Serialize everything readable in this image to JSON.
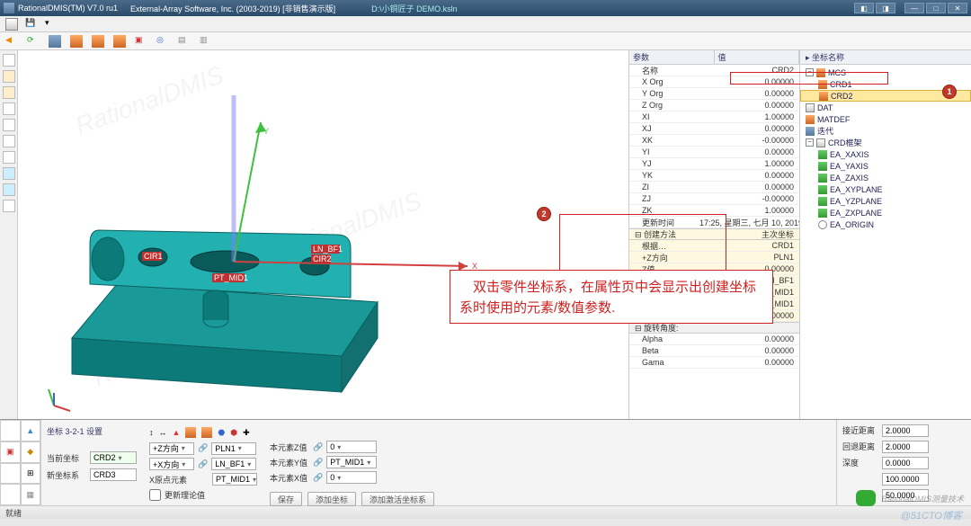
{
  "title": {
    "app": "RationalDMIS(TM) V7.0 ru1",
    "vendor": "External-Array Software, Inc. (2003-2019) [非销售演示版]",
    "file": "D:\\小铜匠子  DEMO.ksln"
  },
  "props": {
    "header_param": "参数",
    "header_value": "值",
    "rows": [
      {
        "k": "名称",
        "v": "CRD2"
      },
      {
        "k": "X Org",
        "v": "0.00000"
      },
      {
        "k": "Y Org",
        "v": "0.00000"
      },
      {
        "k": "Z Org",
        "v": "0.00000"
      },
      {
        "k": "XI",
        "v": "1.00000"
      },
      {
        "k": "XJ",
        "v": "0.00000"
      },
      {
        "k": "XK",
        "v": "-0.00000"
      },
      {
        "k": "YI",
        "v": "0.00000"
      },
      {
        "k": "YJ",
        "v": "1.00000"
      },
      {
        "k": "YK",
        "v": "0.00000"
      },
      {
        "k": "ZI",
        "v": "0.00000"
      },
      {
        "k": "ZJ",
        "v": "-0.00000"
      },
      {
        "k": "ZK",
        "v": "1.00000"
      },
      {
        "k": "更新时间",
        "v": "17:25, 星期三, 七月 10, 2019"
      }
    ],
    "section1": {
      "k": "创建方法",
      "v": "主次坐标"
    },
    "rows2": [
      {
        "k": "根据…",
        "v": "CRD1"
      },
      {
        "k": "+Z方向",
        "v": "PLN1"
      },
      {
        "k": "Z值",
        "v": "0.00000"
      },
      {
        "k": "+X方向",
        "v": "LN_BF1"
      },
      {
        "k": "Y值",
        "v": "PT_MID1"
      },
      {
        "k": "X原点…",
        "v": "PT_MID1"
      },
      {
        "k": "X值",
        "v": "0.00000"
      }
    ],
    "section2": "旋转角度:",
    "rows3": [
      {
        "k": "Alpha",
        "v": "0.00000"
      },
      {
        "k": "Beta",
        "v": "0.00000"
      },
      {
        "k": "Gama",
        "v": "0.00000"
      }
    ]
  },
  "tree": {
    "header": "坐标名称",
    "nodes": {
      "mcs": "MCS",
      "crd1": "CRD1",
      "crd2": "CRD2",
      "dat": "DAT",
      "matdef": "MATDEF",
      "iter": "迭代",
      "frame": "CRD框架",
      "xaxis": "EA_XAXIS",
      "yaxis": "EA_YAXIS",
      "zaxis": "EA_ZAXIS",
      "xyplane": "EA_XYPLANE",
      "yzplane": "EA_YZPLANE",
      "zxplane": "EA_ZXPLANE",
      "origin": "EA_ORIGIN"
    }
  },
  "badges": {
    "b1": "1",
    "b2": "2"
  },
  "annotation": "　双击零件坐标系，在属性页中会显示出创建坐标系时使用的元素/数值参数.",
  "viewport_labels": {
    "cir1": "CIR1",
    "ptmid": "PT_MID1",
    "lnbf": "LN_BF1",
    "cir2": "CIR2",
    "x": "X",
    "y": "Y"
  },
  "bottom": {
    "tab_title": "坐标 3-2-1 设置",
    "l_curr": "当前坐标",
    "l_new": "新坐标系",
    "v_curr": "CRD2",
    "v_new": "CRD3",
    "l_zdir": "+Z方向",
    "l_xdir": "+X方向",
    "l_xorg": "X原点元素",
    "v_zdir": "PLN1",
    "v_xdir": "LN_BF1",
    "v_xorg": "PT_MID1",
    "l_zval": "本元素Z值",
    "l_yval": "本元素Y值",
    "l_xval": "本元素X值",
    "v_zval": "0",
    "v_yval": "PT_MID1",
    "v_xval": "0",
    "chk": "更新理论值",
    "btn1": "保存",
    "btn2": "添加坐标",
    "btn3": "添加激活坐标系",
    "r1_l": "接近距离",
    "r1_v": "2.0000",
    "r2_l": "回退距离",
    "r2_v": "2.0000",
    "r3_l": "深度",
    "r3_v": "0.0000",
    "r4_v": "100.0000",
    "r5_v": "50.0000"
  },
  "status": "就绪",
  "watermark": "RationalDMIS测量技术"
}
